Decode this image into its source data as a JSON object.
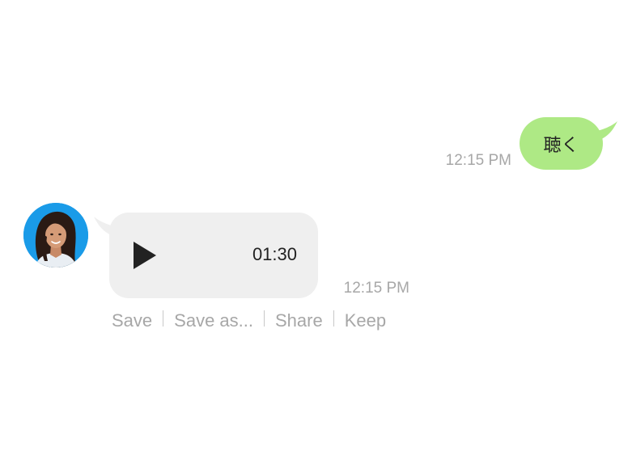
{
  "outgoing": {
    "text": "聴く",
    "time": "12:15 PM",
    "bubble_color": "#aee985"
  },
  "incoming": {
    "avatar_icon": "person-avatar-icon",
    "play_icon": "play-icon",
    "duration": "01:30",
    "time": "12:15 PM",
    "bubble_color": "#efefef"
  },
  "actions": {
    "save": "Save",
    "save_as": "Save as...",
    "share": "Share",
    "keep": "Keep"
  }
}
